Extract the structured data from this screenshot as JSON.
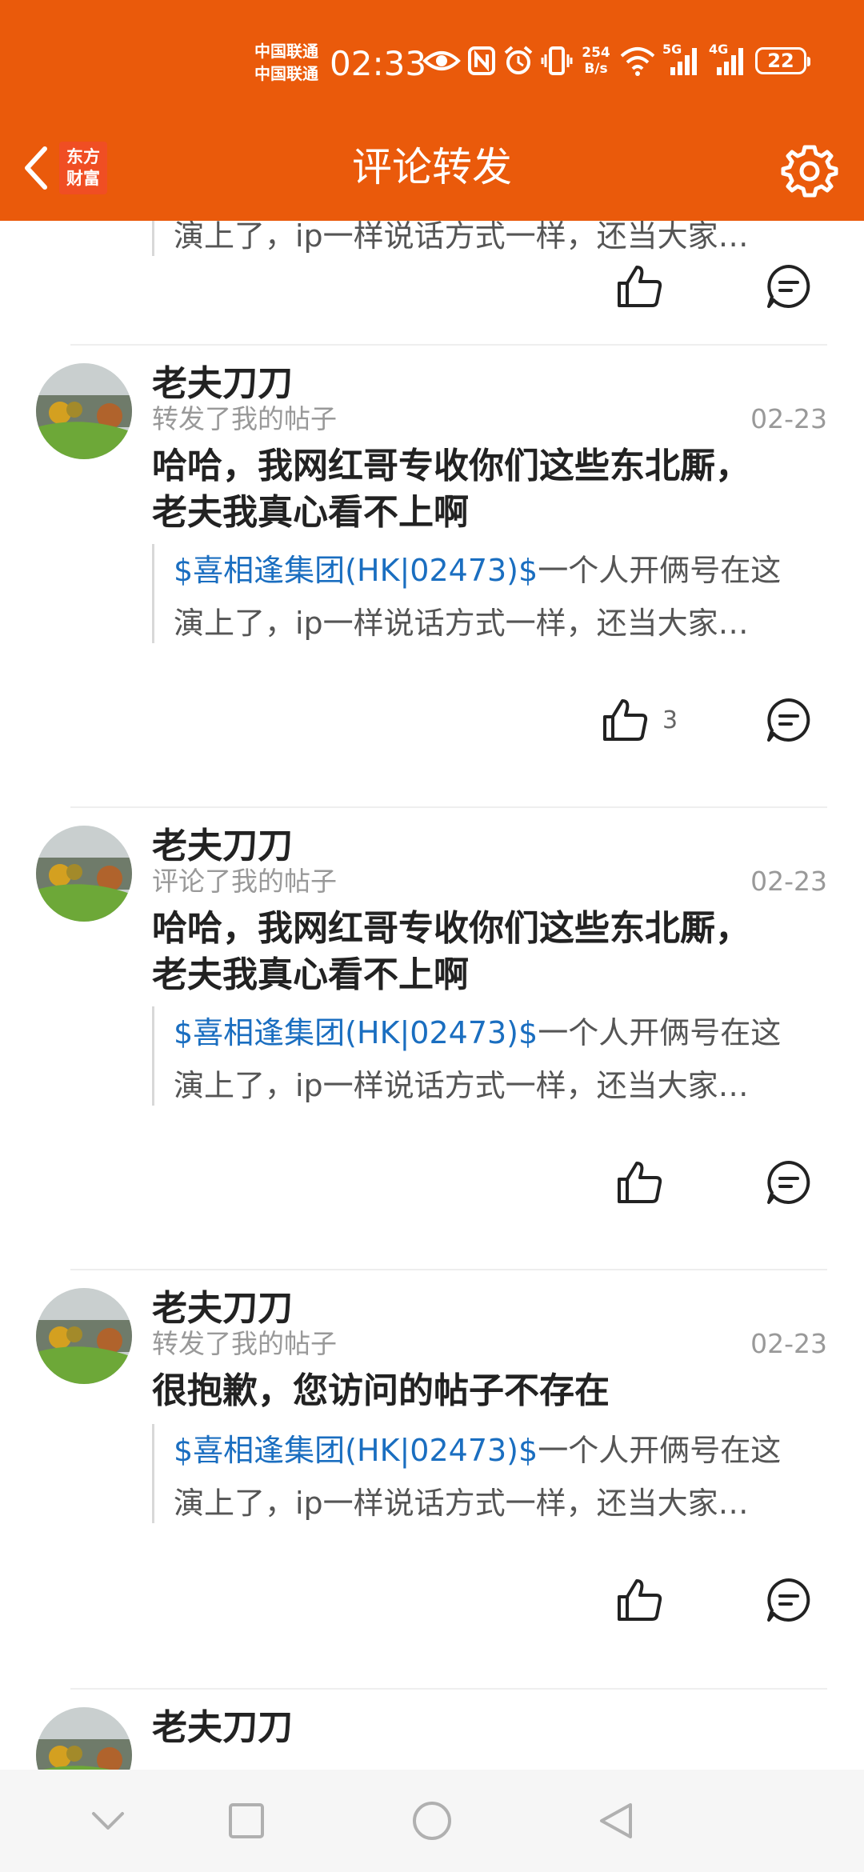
{
  "status_bar": {
    "carrier_1": "中国联通",
    "carrier_2": "中国联通",
    "time": "02:33",
    "net_speed_value": "254",
    "net_speed_unit": "B/s",
    "signal_1_label": "5G",
    "signal_2_label": "4G",
    "battery": "22",
    "icons": [
      "eye-icon",
      "nfc-icon",
      "alarm-icon",
      "vibrate-icon",
      "wifi-icon",
      "signal-icon",
      "battery-icon"
    ]
  },
  "header": {
    "logo_line_1": "东方",
    "logo_line_2": "财富",
    "title": "评论转发",
    "background_color": "#ea5a0b",
    "back_icon": "chevron-left-icon",
    "settings_icon": "gear-icon"
  },
  "feed": {
    "quote_stock": "$喜相逢集团(HK|02473)$",
    "quote_rest_line_1": "一个人开俩号在这",
    "quote_line_2": "演上了，ip一样说话方式一样，还当大家…",
    "top_partial_quote_line_2": "演上了，ip一样说话方式一样，还当大家…",
    "items": [
      {
        "user": "老夫刀刀",
        "action": "转发了我的帖子",
        "date": "02-23",
        "comment_line_1": "哈哈，我网红哥专收你们这些东北厮，",
        "comment_line_2": "老夫我真心看不上啊",
        "likes": "3"
      },
      {
        "user": "老夫刀刀",
        "action": "评论了我的帖子",
        "date": "02-23",
        "comment_line_1": "哈哈，我网红哥专收你们这些东北厮，",
        "comment_line_2": "老夫我真心看不上啊",
        "likes": ""
      },
      {
        "user": "老夫刀刀",
        "action": "转发了我的帖子",
        "date": "02-23",
        "comment_line_1": "很抱歉，您访问的帖子不存在",
        "comment_line_2": "",
        "likes": ""
      },
      {
        "user": "老夫刀刀",
        "action": "",
        "date": "",
        "comment_line_1": "",
        "comment_line_2": "",
        "likes": ""
      }
    ],
    "link_color": "#1a6ec0"
  },
  "system_nav": {
    "icons": [
      "chevron-down-icon",
      "square-icon",
      "circle-icon",
      "triangle-back-icon"
    ]
  }
}
